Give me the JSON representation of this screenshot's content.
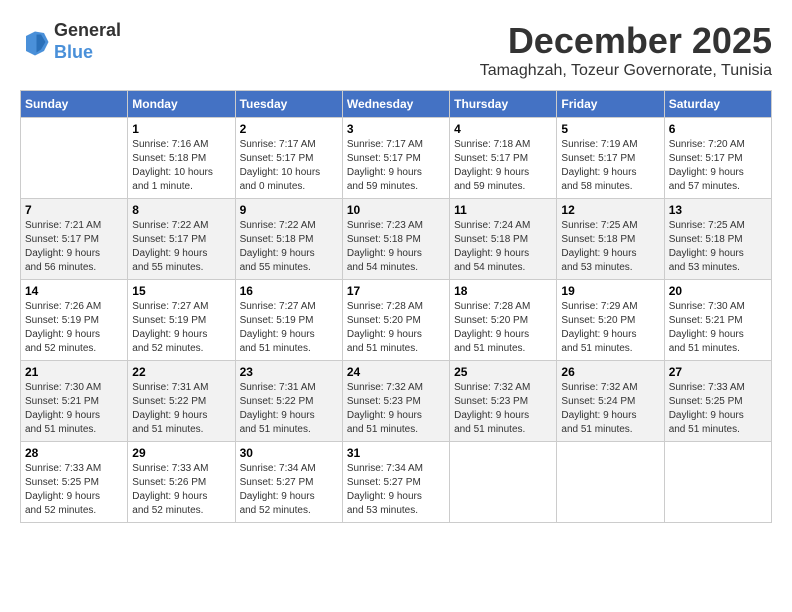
{
  "logo": {
    "general": "General",
    "blue": "Blue"
  },
  "title": "December 2025",
  "subtitle": "Tamaghzah, Tozeur Governorate, Tunisia",
  "days_of_week": [
    "Sunday",
    "Monday",
    "Tuesday",
    "Wednesday",
    "Thursday",
    "Friday",
    "Saturday"
  ],
  "weeks": [
    [
      {
        "day": "",
        "info": ""
      },
      {
        "day": "1",
        "info": "Sunrise: 7:16 AM\nSunset: 5:18 PM\nDaylight: 10 hours\nand 1 minute."
      },
      {
        "day": "2",
        "info": "Sunrise: 7:17 AM\nSunset: 5:17 PM\nDaylight: 10 hours\nand 0 minutes."
      },
      {
        "day": "3",
        "info": "Sunrise: 7:17 AM\nSunset: 5:17 PM\nDaylight: 9 hours\nand 59 minutes."
      },
      {
        "day": "4",
        "info": "Sunrise: 7:18 AM\nSunset: 5:17 PM\nDaylight: 9 hours\nand 59 minutes."
      },
      {
        "day": "5",
        "info": "Sunrise: 7:19 AM\nSunset: 5:17 PM\nDaylight: 9 hours\nand 58 minutes."
      },
      {
        "day": "6",
        "info": "Sunrise: 7:20 AM\nSunset: 5:17 PM\nDaylight: 9 hours\nand 57 minutes."
      }
    ],
    [
      {
        "day": "7",
        "info": "Sunrise: 7:21 AM\nSunset: 5:17 PM\nDaylight: 9 hours\nand 56 minutes."
      },
      {
        "day": "8",
        "info": "Sunrise: 7:22 AM\nSunset: 5:17 PM\nDaylight: 9 hours\nand 55 minutes."
      },
      {
        "day": "9",
        "info": "Sunrise: 7:22 AM\nSunset: 5:18 PM\nDaylight: 9 hours\nand 55 minutes."
      },
      {
        "day": "10",
        "info": "Sunrise: 7:23 AM\nSunset: 5:18 PM\nDaylight: 9 hours\nand 54 minutes."
      },
      {
        "day": "11",
        "info": "Sunrise: 7:24 AM\nSunset: 5:18 PM\nDaylight: 9 hours\nand 54 minutes."
      },
      {
        "day": "12",
        "info": "Sunrise: 7:25 AM\nSunset: 5:18 PM\nDaylight: 9 hours\nand 53 minutes."
      },
      {
        "day": "13",
        "info": "Sunrise: 7:25 AM\nSunset: 5:18 PM\nDaylight: 9 hours\nand 53 minutes."
      }
    ],
    [
      {
        "day": "14",
        "info": "Sunrise: 7:26 AM\nSunset: 5:19 PM\nDaylight: 9 hours\nand 52 minutes."
      },
      {
        "day": "15",
        "info": "Sunrise: 7:27 AM\nSunset: 5:19 PM\nDaylight: 9 hours\nand 52 minutes."
      },
      {
        "day": "16",
        "info": "Sunrise: 7:27 AM\nSunset: 5:19 PM\nDaylight: 9 hours\nand 51 minutes."
      },
      {
        "day": "17",
        "info": "Sunrise: 7:28 AM\nSunset: 5:20 PM\nDaylight: 9 hours\nand 51 minutes."
      },
      {
        "day": "18",
        "info": "Sunrise: 7:28 AM\nSunset: 5:20 PM\nDaylight: 9 hours\nand 51 minutes."
      },
      {
        "day": "19",
        "info": "Sunrise: 7:29 AM\nSunset: 5:20 PM\nDaylight: 9 hours\nand 51 minutes."
      },
      {
        "day": "20",
        "info": "Sunrise: 7:30 AM\nSunset: 5:21 PM\nDaylight: 9 hours\nand 51 minutes."
      }
    ],
    [
      {
        "day": "21",
        "info": "Sunrise: 7:30 AM\nSunset: 5:21 PM\nDaylight: 9 hours\nand 51 minutes."
      },
      {
        "day": "22",
        "info": "Sunrise: 7:31 AM\nSunset: 5:22 PM\nDaylight: 9 hours\nand 51 minutes."
      },
      {
        "day": "23",
        "info": "Sunrise: 7:31 AM\nSunset: 5:22 PM\nDaylight: 9 hours\nand 51 minutes."
      },
      {
        "day": "24",
        "info": "Sunrise: 7:32 AM\nSunset: 5:23 PM\nDaylight: 9 hours\nand 51 minutes."
      },
      {
        "day": "25",
        "info": "Sunrise: 7:32 AM\nSunset: 5:23 PM\nDaylight: 9 hours\nand 51 minutes."
      },
      {
        "day": "26",
        "info": "Sunrise: 7:32 AM\nSunset: 5:24 PM\nDaylight: 9 hours\nand 51 minutes."
      },
      {
        "day": "27",
        "info": "Sunrise: 7:33 AM\nSunset: 5:25 PM\nDaylight: 9 hours\nand 51 minutes."
      }
    ],
    [
      {
        "day": "28",
        "info": "Sunrise: 7:33 AM\nSunset: 5:25 PM\nDaylight: 9 hours\nand 52 minutes."
      },
      {
        "day": "29",
        "info": "Sunrise: 7:33 AM\nSunset: 5:26 PM\nDaylight: 9 hours\nand 52 minutes."
      },
      {
        "day": "30",
        "info": "Sunrise: 7:34 AM\nSunset: 5:27 PM\nDaylight: 9 hours\nand 52 minutes."
      },
      {
        "day": "31",
        "info": "Sunrise: 7:34 AM\nSunset: 5:27 PM\nDaylight: 9 hours\nand 53 minutes."
      },
      {
        "day": "",
        "info": ""
      },
      {
        "day": "",
        "info": ""
      },
      {
        "day": "",
        "info": ""
      }
    ]
  ]
}
